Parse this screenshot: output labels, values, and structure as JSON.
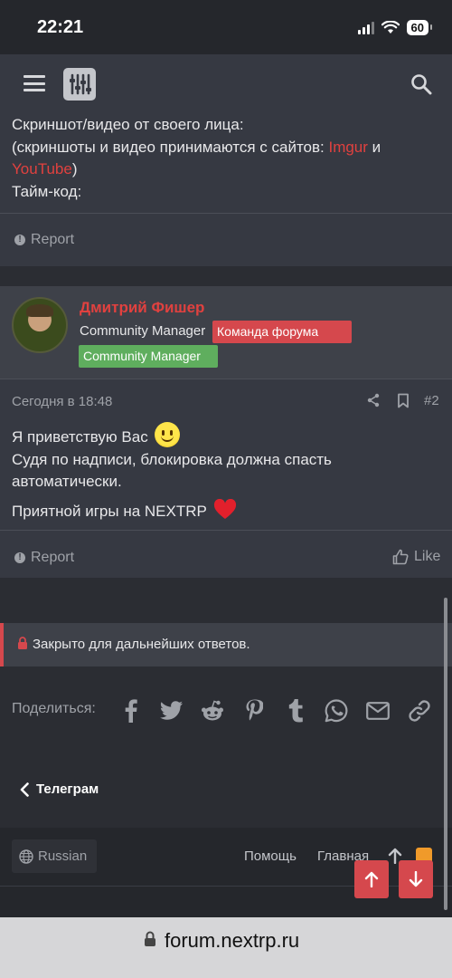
{
  "status_bar": {
    "time": "22:21",
    "battery": "60"
  },
  "post1": {
    "lines": [
      "Скриншот/видео от своего лица:",
      "(скриншоты и видео принимаются с сайтов: ",
      "Imgur",
      " и",
      "YouTube",
      ")",
      "Тайм-код:"
    ],
    "report_label": "Report"
  },
  "post2": {
    "username": "Дмитрий Фишер",
    "user_title": "Community Manager",
    "badge_team": "Команда форума",
    "badge_cm": "Community Manager",
    "date": "Сегодня в 18:48",
    "number": "#2",
    "body": {
      "line1": "Я приветствую Вас",
      "line2": "Судя по надписи, блокировка должна спасть автоматически.",
      "line3": "Приятной игры на NEXTRP"
    },
    "report_label": "Report",
    "like_label": "Like"
  },
  "locked": {
    "text": "Закрыто для дальнейших ответов."
  },
  "share": {
    "label": "Поделиться:",
    "icons": [
      "facebook-icon",
      "twitter-icon",
      "reddit-icon",
      "pinterest-icon",
      "tumblr-icon",
      "whatsapp-icon",
      "email-icon",
      "link-icon"
    ]
  },
  "back_link": {
    "label": "Телеграм"
  },
  "footer": {
    "language": "Russian",
    "help": "Помощь",
    "home": "Главная"
  },
  "url_bar": {
    "domain": "forum.nextrp.ru"
  },
  "colors": {
    "accent": "#d5484d",
    "username": "#e0413f",
    "badge_green": "#5fae5e",
    "link": "#e0413f"
  }
}
